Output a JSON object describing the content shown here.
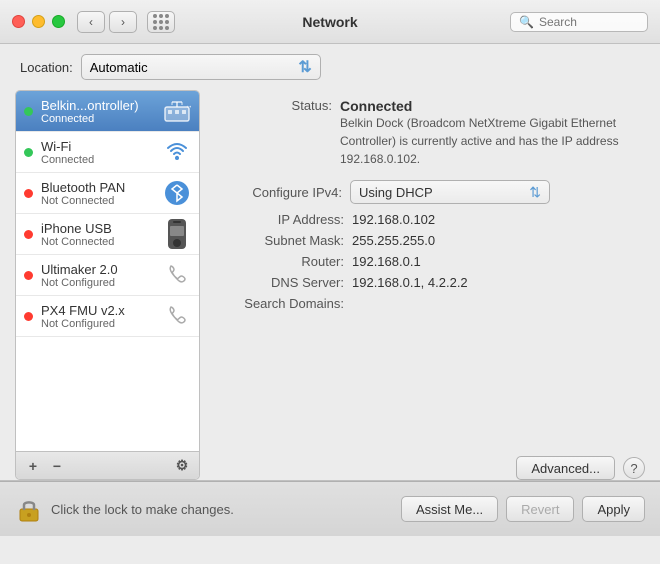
{
  "titlebar": {
    "title": "Network",
    "search_placeholder": "Search"
  },
  "location": {
    "label": "Location:",
    "value": "Automatic"
  },
  "network_items": [
    {
      "id": "belkin",
      "name": "Belkin...ontroller)",
      "status": "Connected",
      "dot": "green",
      "icon": "ethernet",
      "active": true
    },
    {
      "id": "wifi",
      "name": "Wi-Fi",
      "status": "Connected",
      "dot": "green",
      "icon": "wifi",
      "active": false
    },
    {
      "id": "bluetooth-pan",
      "name": "Bluetooth PAN",
      "status": "Not Connected",
      "dot": "red",
      "icon": "bluetooth",
      "active": false
    },
    {
      "id": "iphone-usb",
      "name": "iPhone USB",
      "status": "Not Connected",
      "dot": "red",
      "icon": "iphone",
      "active": false
    },
    {
      "id": "ultimaker",
      "name": "Ultimaker 2.0",
      "status": "Not Configured",
      "dot": "red",
      "icon": "phone",
      "active": false
    },
    {
      "id": "px4",
      "name": "PX4 FMU v2.x",
      "status": "Not Configured",
      "dot": "red",
      "icon": "phone",
      "active": false
    }
  ],
  "list_controls": {
    "add": "+",
    "remove": "−",
    "gear": "⚙"
  },
  "detail": {
    "status_label": "Status:",
    "status_value": "Connected",
    "description": "Belkin Dock (Broadcom NetXtreme Gigabit Ethernet Controller) is currently active and has the IP address 192.168.0.102.",
    "configure_label": "Configure IPv4:",
    "configure_value": "Using DHCP",
    "ip_label": "IP Address:",
    "ip_value": "192.168.0.102",
    "subnet_label": "Subnet Mask:",
    "subnet_value": "255.255.255.0",
    "router_label": "Router:",
    "router_value": "192.168.0.1",
    "dns_label": "DNS Server:",
    "dns_value": "192.168.0.1, 4.2.2.2",
    "search_domains_label": "Search Domains:",
    "search_domains_value": "",
    "advanced_btn": "Advanced...",
    "help": "?"
  },
  "bottom": {
    "lock_text": "Click the lock to make changes.",
    "assist_btn": "Assist Me...",
    "revert_btn": "Revert",
    "apply_btn": "Apply"
  }
}
